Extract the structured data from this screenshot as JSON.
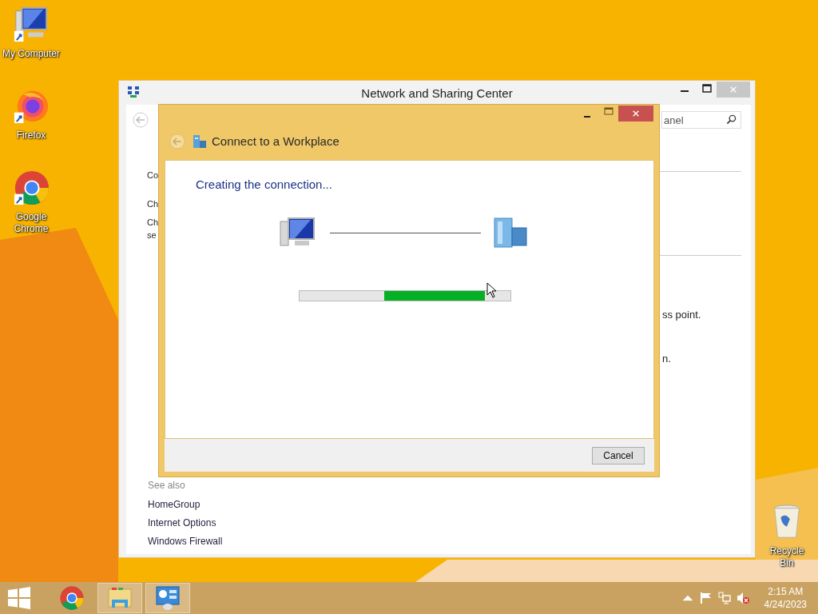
{
  "desktop_icons": [
    {
      "kind": "computer",
      "label": "My Computer"
    },
    {
      "kind": "firefox",
      "label": "Firefox"
    },
    {
      "kind": "chrome",
      "label": "Google Chrome"
    },
    {
      "kind": "recycle-bin",
      "label": "Recycle Bin"
    }
  ],
  "background_window": {
    "title": "Network and Sharing Center",
    "search": {
      "placeholder": "anel"
    },
    "left_texts": [
      "Co",
      "Ch",
      "Ch",
      "se"
    ],
    "right_texts": [
      "ss point.",
      "n."
    ],
    "see_also": {
      "heading": "See also",
      "links": [
        "HomeGroup",
        "Internet Options",
        "Windows Firewall"
      ]
    }
  },
  "dialog": {
    "title": "Connect to a Workplace",
    "heading": "Creating the connection...",
    "buttons": [
      "Cancel"
    ]
  },
  "taskbar": {
    "apps": [
      {
        "kind": "chrome",
        "running": false
      },
      {
        "kind": "explorer",
        "running": true
      },
      {
        "kind": "control-panel",
        "running": true
      }
    ],
    "clock": {
      "time": "2:15 AM",
      "date": "4/24/2023"
    }
  }
}
